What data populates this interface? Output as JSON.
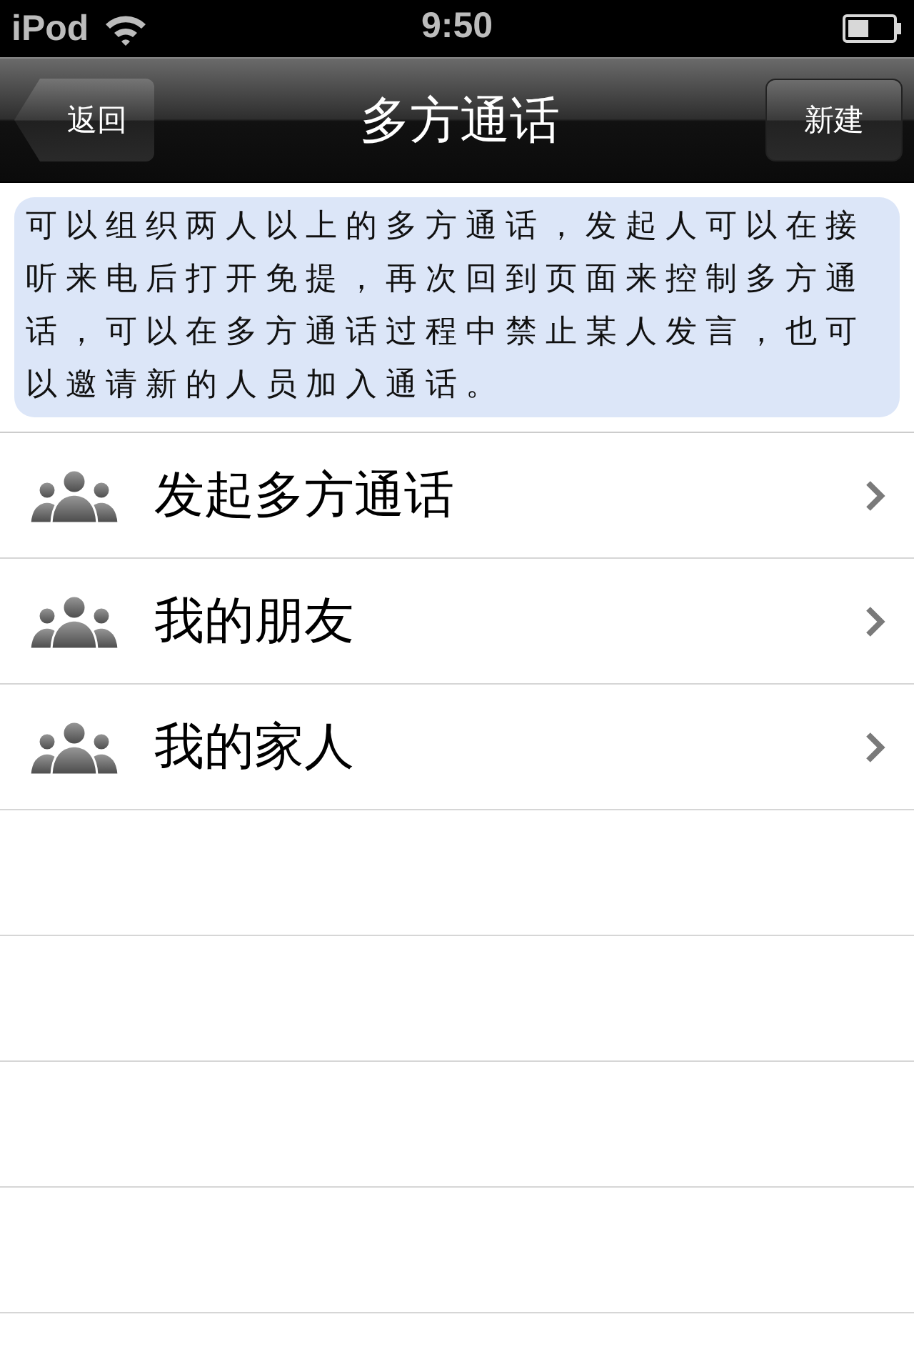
{
  "status_bar": {
    "carrier": "iPod",
    "time": "9:50"
  },
  "nav_bar": {
    "back_button": "返回",
    "title": "多方通话",
    "right_button": "新建"
  },
  "intro": "可以组织两人以上的多方通话，发起人可以在接听来电后打开免提，再次回到页面来控制多方通话，可以在多方通话过程中禁止某人发言，也可以邀请新的人员加入通话。",
  "menu_items": [
    {
      "label": "发起多方通话"
    },
    {
      "label": "我的朋友"
    },
    {
      "label": "我的家人"
    }
  ]
}
